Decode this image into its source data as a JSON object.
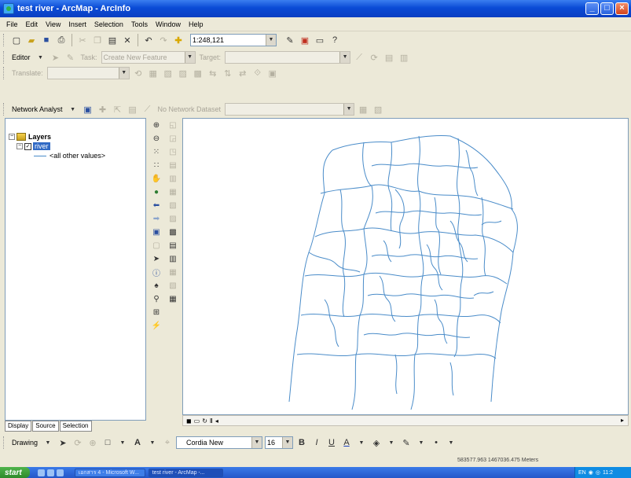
{
  "window": {
    "title": "test river - ArcMap - ArcInfo",
    "buttons": [
      "_",
      "□",
      "×"
    ]
  },
  "menu": [
    "File",
    "Edit",
    "View",
    "Insert",
    "Selection",
    "Tools",
    "Window",
    "Help"
  ],
  "standard_toolbar": {
    "scale_value": "1:248,121"
  },
  "editor_toolbar": {
    "label": "Editor",
    "task_label": "Task:",
    "task_value": "Create New Feature",
    "target_label": "Target:",
    "target_value": ""
  },
  "translate_toolbar": {
    "label": "Translate:"
  },
  "network_toolbar": {
    "label": "Network Analyst",
    "network_dataset_label": "No Network Dataset"
  },
  "toc": {
    "root_label": "Layers",
    "layer_name": "river",
    "legend_label": "<all other values>",
    "tabs": [
      "Display",
      "Source",
      "Selection"
    ]
  },
  "drawing_toolbar": {
    "label": "Drawing",
    "font_name": "Cordia New",
    "font_size": "16",
    "bold": "B",
    "italic": "I",
    "underline": "U"
  },
  "status": {
    "coordinates": "583577.963  1467036.475 Meters"
  },
  "taskbar": {
    "start_label": "start",
    "tasks": [
      "เอกสาร 4 - Microsoft W...",
      "test river - ArcMap -..."
    ],
    "tray_lang": "EN",
    "clock": "11:2"
  },
  "colors": {
    "title_bar": "#0a4bd6",
    "map_lines": "#4a8cc9",
    "selected_layer": "#316ac5"
  }
}
